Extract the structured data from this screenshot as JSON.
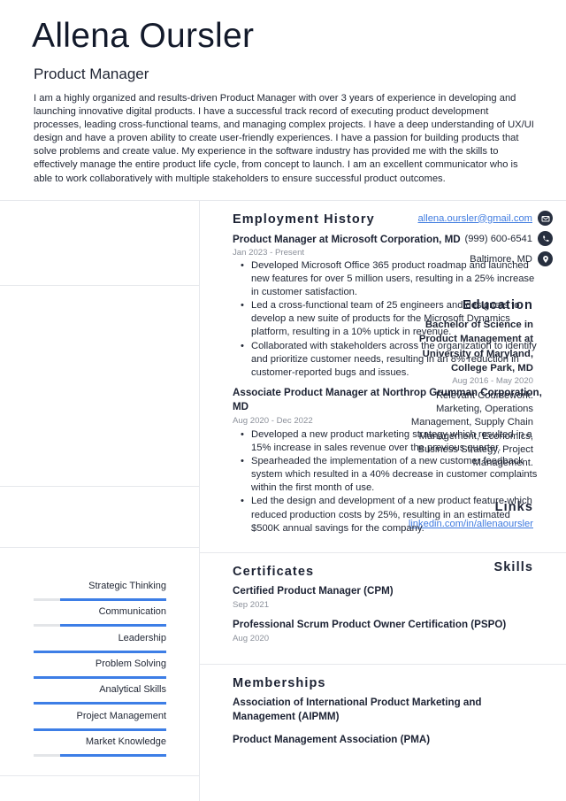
{
  "header": {
    "name": "Allena Oursler",
    "role": "Product Manager",
    "summary": "I am a highly organized and results-driven Product Manager with over 3 years of experience in developing and launching innovative digital products. I have a successful track record of executing product development processes, leading cross-functional teams, and managing complex projects. I have a deep understanding of UX/UI design and have a proven ability to create user-friendly experiences. I have a passion for building products that solve problems and create value. My experience in the software industry has provided me with the skills to effectively manage the entire product life cycle, from concept to launch. I am an excellent communicator who is able to work collaboratively with multiple stakeholders to ensure successful product outcomes."
  },
  "contact": {
    "email": "allena.oursler@gmail.com",
    "phone": "(999) 600-6541",
    "location": "Baltimore, MD",
    "icons": [
      "envelope-icon",
      "phone-icon",
      "map-pin-icon"
    ]
  },
  "education": {
    "title": "Education",
    "degree": "Bachelor of Science in Product Management at University of Maryland, College Park, MD",
    "date": "Aug 2016 - May 2020",
    "coursework": "Relevant Coursework: Marketing, Operations Management, Supply Chain Management, Economics, Business Strategy, Project Management."
  },
  "links": {
    "title": "Links",
    "items": [
      "linkedin.com/in/allenaoursler"
    ]
  },
  "skills": {
    "title": "Skills",
    "accent": "#3d7ee6",
    "items": [
      {
        "name": "Strategic Thinking",
        "level": 0.8
      },
      {
        "name": "Communication",
        "level": 0.8
      },
      {
        "name": "Leadership",
        "level": 1.0
      },
      {
        "name": "Problem Solving",
        "level": 1.0
      },
      {
        "name": "Analytical Skills",
        "level": 1.0
      },
      {
        "name": "Project Management",
        "level": 1.0
      },
      {
        "name": "Market Knowledge",
        "level": 0.8
      }
    ]
  },
  "employment": {
    "title": "Employment History",
    "jobs": [
      {
        "title": "Product Manager at Microsoft Corporation, MD",
        "date": "Jan 2023 - Present",
        "bullets": [
          "Developed Microsoft Office 365 product roadmap and launched new features for over 5 million users, resulting in a 25% increase in customer satisfaction.",
          "Led a cross-functional team of 25 engineers and designers to develop a new suite of products for the Microsoft Dynamics platform, resulting in a 10% uptick in revenue.",
          "Collaborated with stakeholders across the organization to identify and prioritize customer needs, resulting in an 8% reduction in customer-reported bugs and issues."
        ]
      },
      {
        "title": "Associate Product Manager at Northrop Grumman Corporation, MD",
        "date": "Aug 2020 - Dec 2022",
        "bullets": [
          "Developed a new product marketing strategy which resulted in a 15% increase in sales revenue over the previous quarter.",
          "Spearheaded the implementation of a new customer feedback system which resulted in a 40% decrease in customer complaints within the first month of use.",
          "Led the design and development of a new product feature which reduced production costs by 25%, resulting in an estimated $500K annual savings for the company."
        ]
      }
    ]
  },
  "certificates": {
    "title": "Certificates",
    "items": [
      {
        "name": "Certified Product Manager (CPM)",
        "date": "Sep 2021"
      },
      {
        "name": "Professional Scrum Product Owner Certification (PSPO)",
        "date": "Aug 2020"
      }
    ]
  },
  "memberships": {
    "title": "Memberships",
    "items": [
      "Association of International Product Marketing and Management (AIPMM)",
      "Product Management Association (PMA)"
    ]
  }
}
